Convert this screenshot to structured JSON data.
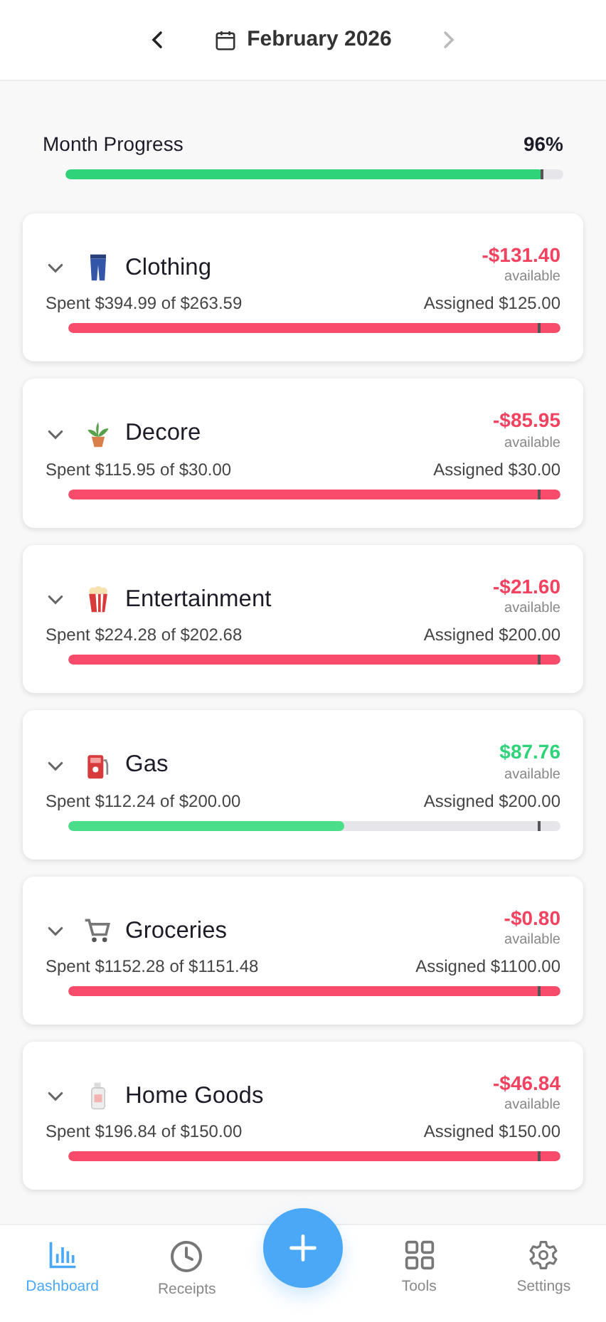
{
  "header": {
    "month": "February 2026",
    "prev_enabled": true,
    "next_enabled": false
  },
  "month_progress": {
    "label": "Month Progress",
    "value": "96%",
    "level": 0.96
  },
  "categories": [
    {
      "kind": "jeans",
      "name": "Clothing",
      "available": "-$131.40",
      "available_label": "available",
      "spent": "Spent $394.99 of $263.59",
      "assigned": "Assigned $125.00",
      "over": true,
      "level": 1
    },
    {
      "kind": "plant",
      "name": "Decore",
      "available": "-$85.95",
      "available_label": "available",
      "spent": "Spent $115.95 of $30.00",
      "assigned": "Assigned $30.00",
      "over": true,
      "level": 1
    },
    {
      "kind": "popcorn",
      "name": "Entertainment",
      "available": "-$21.60",
      "available_label": "available",
      "spent": "Spent $224.28 of $202.68",
      "assigned": "Assigned $200.00",
      "over": true,
      "level": 1
    },
    {
      "kind": "fuel",
      "name": "Gas",
      "available": "$87.76",
      "available_label": "available",
      "spent": "Spent $112.24 of $200.00",
      "assigned": "Assigned $200.00",
      "over": false,
      "level": 0.56
    },
    {
      "kind": "cart",
      "name": "Groceries",
      "available": "-$0.80",
      "available_label": "available",
      "spent": "Spent $1152.28 of $1151.48",
      "assigned": "Assigned $1100.00",
      "over": true,
      "level": 1
    },
    {
      "kind": "bottle",
      "name": "Home Goods",
      "available": "-$46.84",
      "available_label": "available",
      "spent": "Spent $196.84 of $150.00",
      "assigned": "Assigned $150.00",
      "over": true,
      "level": 1
    }
  ],
  "nav": [
    {
      "kind": "chart",
      "label": "Dashboard",
      "selected": true
    },
    {
      "kind": "clock",
      "label": "Receipts",
      "selected": false
    },
    {
      "kind": "add",
      "selected": false
    },
    {
      "kind": "grid",
      "label": "Tools",
      "selected": false
    },
    {
      "kind": "gear",
      "label": "Settings",
      "selected": false
    }
  ]
}
